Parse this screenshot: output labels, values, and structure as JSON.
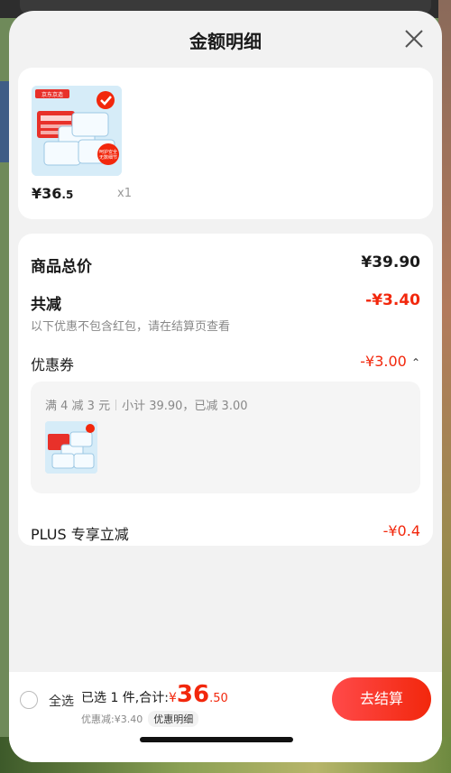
{
  "header": {
    "title": "金额明细"
  },
  "product": {
    "price_symbol": "¥",
    "price_int": "36",
    "price_dec": ".5",
    "quantity": "x1",
    "image_badge": "京东京造",
    "image_caption": "呵护安全 无数细节"
  },
  "detail": {
    "total_label": "商品总价",
    "total_value": "¥39.90",
    "reduce_label": "共减",
    "reduce_value": "-¥3.40",
    "reduce_note": "以下优惠不包含红包，请在结算页查看",
    "coupon_label": "优惠券",
    "coupon_value": "-¥3.00",
    "coupon_rule": "满 4 减 3 元",
    "coupon_summary": "小计 39.90，已减 3.00",
    "plus_label": "PLUS 专享立减",
    "plus_value": "-¥0.4"
  },
  "bottom": {
    "select_all": "全选",
    "selected_text": "已选 1 件,合计:",
    "currency": "¥",
    "total_int": "36",
    "total_dec": ".50",
    "discount_text": "优惠减:¥3.40",
    "detail_tag": "优惠明细",
    "checkout_label": "去结算"
  },
  "colors": {
    "accent": "#f2270c",
    "background": "#f2f2f2"
  }
}
